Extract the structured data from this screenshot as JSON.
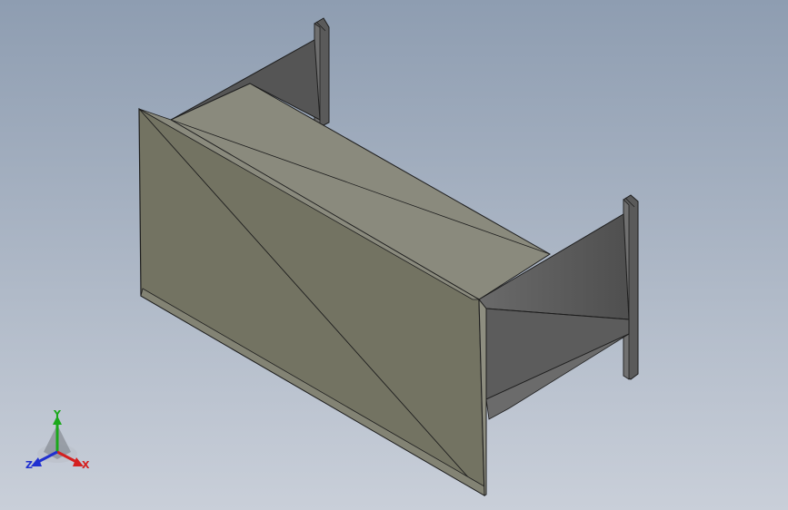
{
  "viewport": {
    "background_top": "#8e9db1",
    "background_bottom": "#c9cfd9"
  },
  "model": {
    "body_color": "#737362",
    "top_color": "#8a8a7d",
    "dark_color": "#5d5d5d",
    "edge_color": "#1e1e1e"
  },
  "triad": {
    "x_label": "X",
    "y_label": "Y",
    "z_label": "Z",
    "x_color": "#d42020",
    "y_color": "#1aa81a",
    "z_color": "#2030d0"
  }
}
